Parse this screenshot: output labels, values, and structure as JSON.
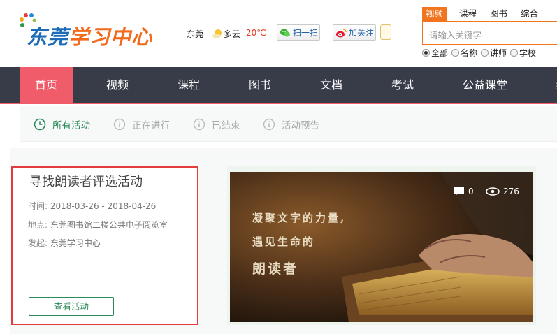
{
  "site": {
    "logo_part1": "东莞",
    "logo_part2": "学习中心"
  },
  "header": {
    "city": "东莞",
    "weather": "多云",
    "temperature": "20℃",
    "scan_label": "扫一扫",
    "follow_label": "加关注"
  },
  "search": {
    "tabs": [
      {
        "label": "视频",
        "active": true
      },
      {
        "label": "课程"
      },
      {
        "label": "图书"
      },
      {
        "label": "综合"
      }
    ],
    "placeholder": "请输入关键字",
    "scopes": [
      {
        "label": "全部",
        "selected": true
      },
      {
        "label": "名称"
      },
      {
        "label": "讲师"
      },
      {
        "label": "学校"
      }
    ]
  },
  "nav": {
    "items": [
      {
        "label": "首页",
        "active": true
      },
      {
        "label": "视频"
      },
      {
        "label": "课程"
      },
      {
        "label": "图书"
      },
      {
        "label": "文档"
      },
      {
        "label": "考试"
      },
      {
        "label": "公益课堂"
      }
    ]
  },
  "filters": {
    "items": [
      {
        "label": "所有活动",
        "active": true,
        "icon": "clock-icon"
      },
      {
        "label": "正在进行",
        "icon": "info-icon"
      },
      {
        "label": "已结束",
        "icon": "info-icon"
      },
      {
        "label": "活动预告",
        "icon": "info-icon"
      }
    ]
  },
  "activity": {
    "title": "寻找朗读者评选活动",
    "time_label": "时间:",
    "time_value": "2018-03-26 - 2018-04-26",
    "place_label": "地点:",
    "place_value": "东莞图书馆二楼公共电子阅览室",
    "organizer_label": "发起:",
    "organizer_value": "东莞学习中心",
    "button_label": "查看活动",
    "comments": "0",
    "views": "276",
    "banner_line1": "凝聚文字的力量,",
    "banner_line2": "遇见生命的",
    "banner_line3": "朗读者"
  },
  "colors": {
    "nav_bg": "#373c48",
    "nav_active": "#f05c6a",
    "accent_orange": "#f2741e",
    "accent_green": "#2a8a5a",
    "highlight_red": "#e23c3c"
  }
}
